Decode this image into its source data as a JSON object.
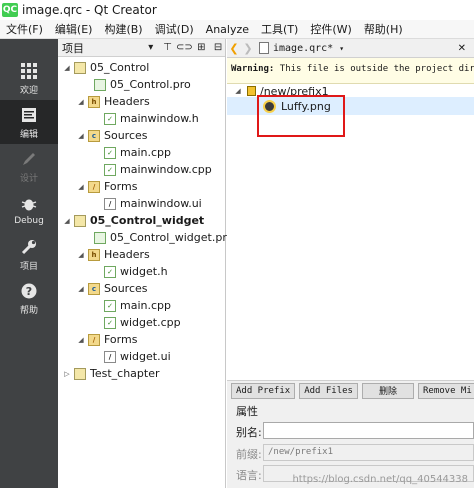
{
  "window": {
    "title": "image.qrc - Qt Creator",
    "app_icon": "QC"
  },
  "menu": [
    "文件(F)",
    "编辑(E)",
    "构建(B)",
    "调试(D)",
    "Analyze",
    "工具(T)",
    "控件(W)",
    "帮助(H)"
  ],
  "modes": [
    {
      "label": "欢迎",
      "icon": "grid-icon",
      "state": "normal"
    },
    {
      "label": "编辑",
      "icon": "edit-icon",
      "state": "active"
    },
    {
      "label": "设计",
      "icon": "pen-icon",
      "state": "disabled"
    },
    {
      "label": "Debug",
      "icon": "bug-icon",
      "state": "normal"
    },
    {
      "label": "项目",
      "icon": "wrench-icon",
      "state": "normal"
    },
    {
      "label": "帮助",
      "icon": "help-icon",
      "state": "normal"
    }
  ],
  "project_pane": {
    "combo": "项目",
    "tree": [
      {
        "label": "05_Control",
        "icon": "project",
        "bold": false
      },
      {
        "label": "05_Control.pro",
        "icon": "pro"
      },
      {
        "label": "Headers",
        "icon": "folder-h"
      },
      {
        "label": "mainwindow.h",
        "icon": "file"
      },
      {
        "label": "Sources",
        "icon": "folder-c"
      },
      {
        "label": "main.cpp",
        "icon": "file"
      },
      {
        "label": "mainwindow.cpp",
        "icon": "file"
      },
      {
        "label": "Forms",
        "icon": "folder-f"
      },
      {
        "label": "mainwindow.ui",
        "icon": "file"
      },
      {
        "label": "05_Control_widget",
        "icon": "project",
        "bold": true
      },
      {
        "label": "05_Control_widget.pro",
        "icon": "pro"
      },
      {
        "label": "Headers",
        "icon": "folder-h"
      },
      {
        "label": "widget.h",
        "icon": "file"
      },
      {
        "label": "Sources",
        "icon": "folder-c"
      },
      {
        "label": "main.cpp",
        "icon": "file"
      },
      {
        "label": "widget.cpp",
        "icon": "file"
      },
      {
        "label": "Forms",
        "icon": "folder-f"
      },
      {
        "label": "widget.ui",
        "icon": "file"
      },
      {
        "label": "Test_chapter",
        "icon": "project"
      }
    ]
  },
  "editor": {
    "filename": "image.qrc*",
    "warning_prefix": "Warning:",
    "warning_text": " This file is outside the project direct",
    "prefix": "/new/prefix1",
    "resource": "Luffy.png"
  },
  "buttons": {
    "add_prefix": "Add Prefix",
    "add_files": "Add Files",
    "delete": "删除",
    "remove_missing": "Remove Mi"
  },
  "properties": {
    "title": "属性",
    "alias_label": "别名:",
    "alias_value": "",
    "prefix_label": "前缀:",
    "prefix_value": "/new/prefix1",
    "language_label": "语言:",
    "language_value": ""
  },
  "watermark": "https://blog.csdn.net/qq_40544338"
}
